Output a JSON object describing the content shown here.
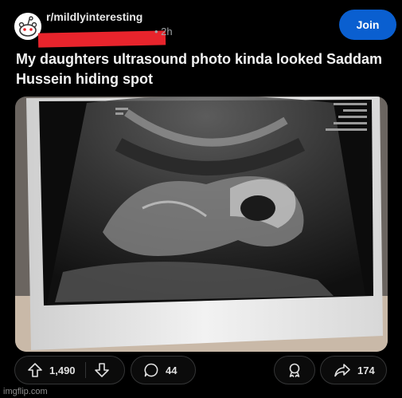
{
  "post": {
    "subreddit": "r/mildlyinteresting",
    "time_meta": "• 2h",
    "join_label": "Join",
    "title": "My daughters ultrasound photo kinda looked Saddam Hussein hiding spot"
  },
  "actions": {
    "upvotes": "1,490",
    "comments": "44",
    "shares": "174"
  },
  "watermark": "imgflip.com",
  "colors": {
    "background": "#000000",
    "join_button": "#0a5fd0",
    "redaction": "#e8242c"
  }
}
